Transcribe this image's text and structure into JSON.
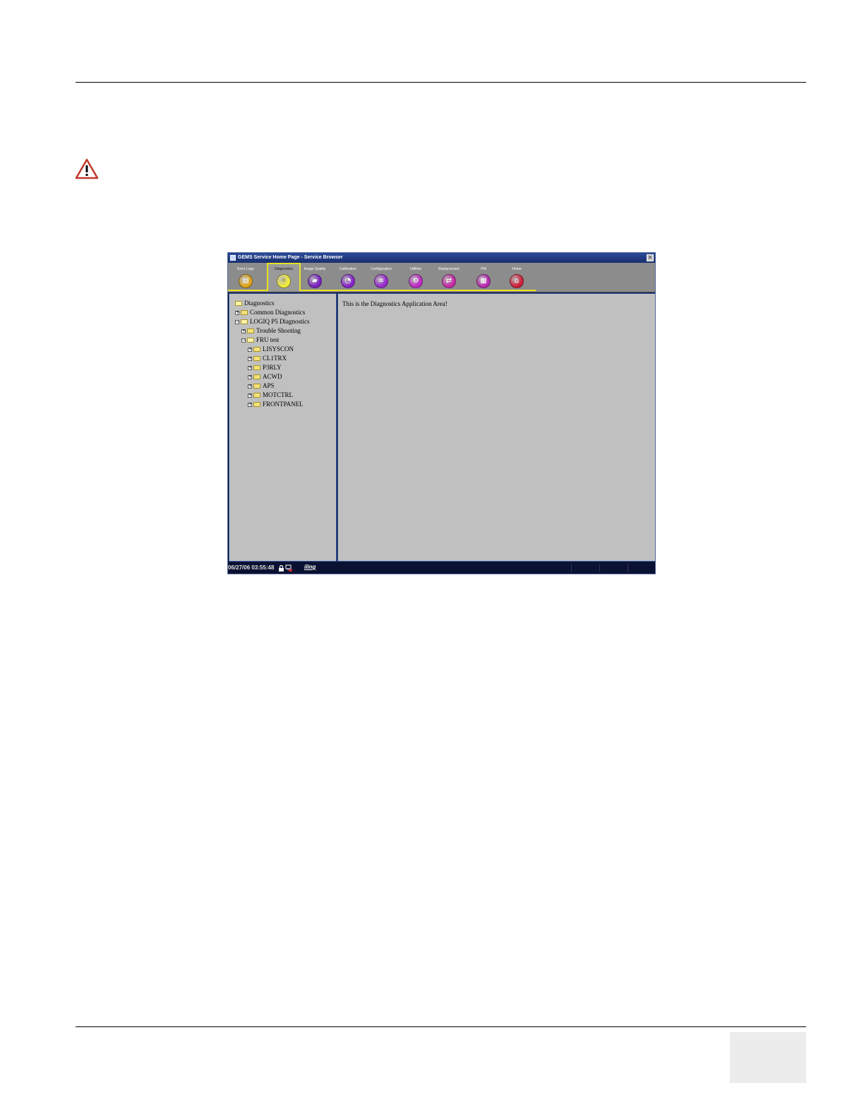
{
  "window": {
    "title": "GEMS Service Home Page - Service Browser",
    "close_glyph": "✕"
  },
  "toolbar": {
    "tabs": [
      {
        "label": "Error Logs",
        "icon": "error-logs-icon",
        "color": "#e0a61a",
        "glyph": "▤",
        "active": false
      },
      {
        "label": "Diagnostics",
        "icon": "diagnostics-icon",
        "color": "#f0ea3a",
        "glyph": "✧",
        "active": true
      },
      {
        "label": "Image Quality",
        "icon": "image-quality-icon",
        "color": "#7a22c2",
        "glyph": "▰",
        "active": false
      },
      {
        "label": "Calibration",
        "icon": "calibration-icon",
        "color": "#8a24c8",
        "glyph": "◔",
        "active": false
      },
      {
        "label": "Configuration",
        "icon": "configuration-icon",
        "color": "#9a2ad0",
        "glyph": "≡",
        "active": false
      },
      {
        "label": "Utilities",
        "icon": "utilities-icon",
        "color": "#c02ac8",
        "glyph": "⚙",
        "active": false
      },
      {
        "label": "Replacement",
        "icon": "replacement-icon",
        "color": "#c82aa8",
        "glyph": "⇄",
        "active": false
      },
      {
        "label": "PM",
        "icon": "pm-icon",
        "color": "#b82ab0",
        "glyph": "▦",
        "active": false
      },
      {
        "label": "Home",
        "icon": "home-icon",
        "color": "#d0203a",
        "glyph": "⌂",
        "active": false
      }
    ]
  },
  "tree": {
    "nodes": [
      {
        "label": "Diagnostics",
        "level": 0,
        "expander": "",
        "open": true
      },
      {
        "label": "Common Diagnostics",
        "level": 0,
        "expander": "+",
        "open": false
      },
      {
        "label": "LOGIQ P5 Diagnostics",
        "level": 0,
        "expander": "−",
        "open": true
      },
      {
        "label": "Trouble Shooting",
        "level": 1,
        "expander": "+",
        "open": false
      },
      {
        "label": "FRU test",
        "level": 1,
        "expander": "−",
        "open": true
      },
      {
        "label": "LISYSCON",
        "level": 2,
        "expander": "+",
        "open": false
      },
      {
        "label": "CL1TRX",
        "level": 2,
        "expander": "+",
        "open": false
      },
      {
        "label": "P3RLY",
        "level": 2,
        "expander": "+",
        "open": false
      },
      {
        "label": "ACWD",
        "level": 2,
        "expander": "+",
        "open": false
      },
      {
        "label": "APS",
        "level": 2,
        "expander": "+",
        "open": false
      },
      {
        "label": "MOTCTRL",
        "level": 2,
        "expander": "+",
        "open": false
      },
      {
        "label": "FRONTPANEL",
        "level": 2,
        "expander": "+",
        "open": false
      }
    ]
  },
  "content": {
    "text": "This is the Diagnostics Application Area!"
  },
  "statusbar": {
    "datetime": "06/27/06 03:55:48",
    "logo": "iling"
  }
}
